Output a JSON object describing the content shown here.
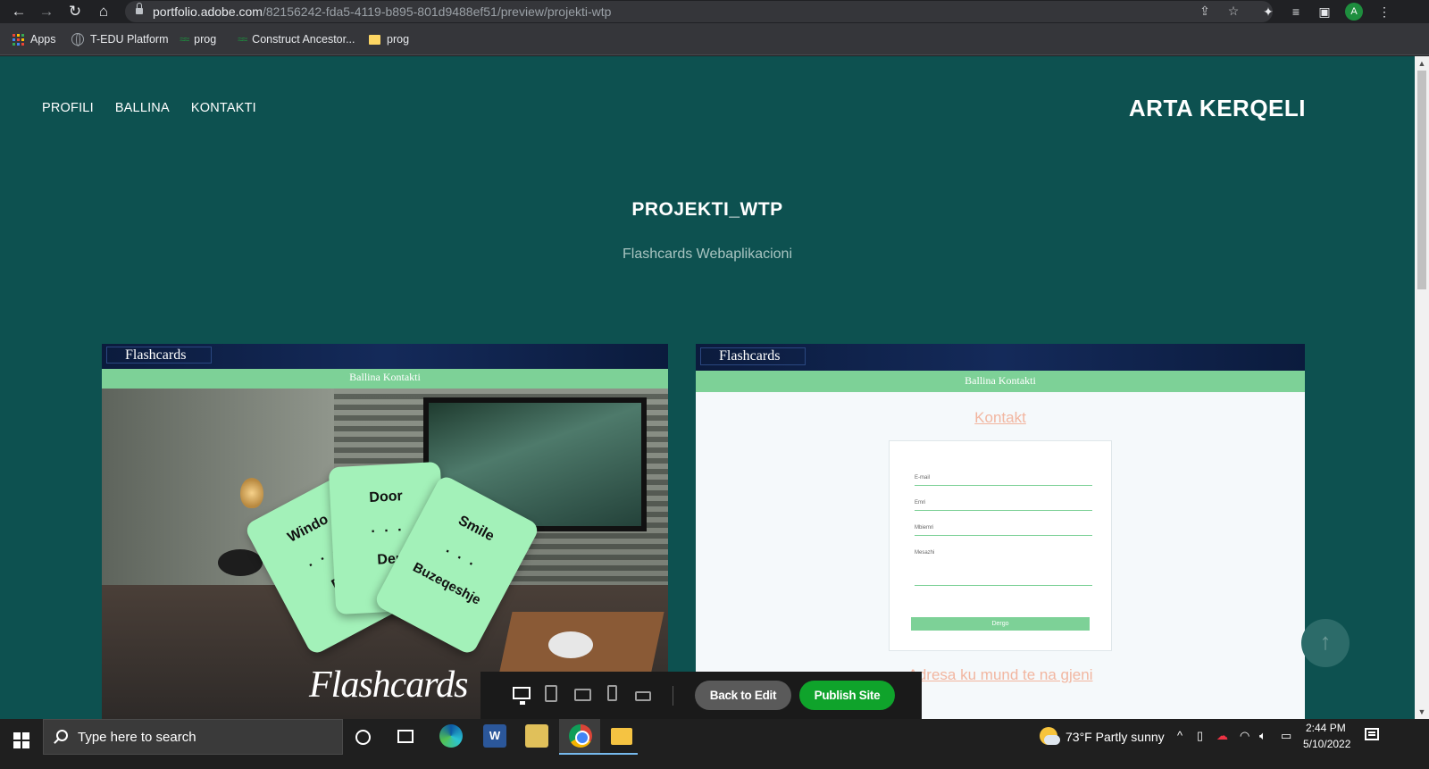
{
  "browser": {
    "url_host": "portfolio.adobe.com",
    "url_path": "/82156242-fda5-4119-b895-801d9488ef51/preview/projekti-wtp",
    "profile_initial": "A",
    "bookmarks": [
      {
        "label": "Apps",
        "icon": "apps-grid-icon"
      },
      {
        "label": "T-EDU Platform",
        "icon": "globe-icon"
      },
      {
        "label": "prog",
        "icon": "wave-icon"
      },
      {
        "label": "Construct Ancestor...",
        "icon": "wave-icon"
      },
      {
        "label": "prog",
        "icon": "folder-icon"
      }
    ]
  },
  "site": {
    "nav": [
      "PROFILI",
      "BALLINA",
      "KONTAKTI"
    ],
    "brand": "ARTA KERQELI",
    "project_title": "PROJEKTI_WTP",
    "project_subtitle": "Flashcards Webaplikacioni",
    "accent_color": "#0d5150"
  },
  "thumb1": {
    "logo": "Flashcards",
    "menu": "Ballina    Kontakti",
    "cards": [
      {
        "word": "Windo",
        "dots": ". . .",
        "trans": "D"
      },
      {
        "word": "Door",
        "dots": ". . .",
        "trans": "Der"
      },
      {
        "word": "Smile",
        "dots": ". . .",
        "trans": "Buzeqeshje"
      }
    ],
    "script_logo": "Flashcards"
  },
  "thumb2": {
    "logo": "Flashcards",
    "menu": "Ballina    Kontakti",
    "contact_title": "Kontakt",
    "fields": [
      "E-mail",
      "Emri",
      "Mbiemri"
    ],
    "textarea": "Mesazhi",
    "submit": "Dergo",
    "address_link": "Adresa ku mund te na gjeni"
  },
  "toolbar": {
    "back_label": "Back to Edit",
    "publish_label": "Publish Site",
    "publish_color": "#0fa32b"
  },
  "taskbar": {
    "search_placeholder": "Type here to search",
    "word_letter": "W",
    "weather": "73°F  Partly sunny",
    "time": "2:44 PM",
    "date": "5/10/2022"
  }
}
